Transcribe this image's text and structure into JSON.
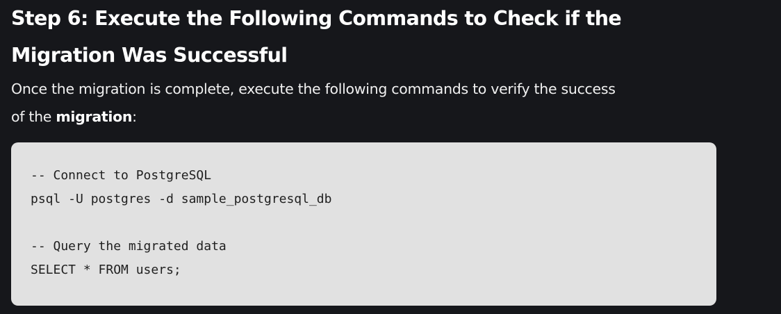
{
  "heading": {
    "line1": "Step 6: Execute the Following Commands to Check if the",
    "line2": "Migration Was Successful"
  },
  "paragraph": {
    "line1": "Once the migration is complete, execute the following commands to verify the success",
    "line2_prefix": "of the ",
    "line2_bold": "migration",
    "line2_suffix": ":"
  },
  "code": {
    "lines": [
      "-- Connect to PostgreSQL",
      "psql -U postgres -d sample_postgresql_db",
      "",
      "-- Query the migrated data",
      "SELECT * FROM users;"
    ]
  }
}
